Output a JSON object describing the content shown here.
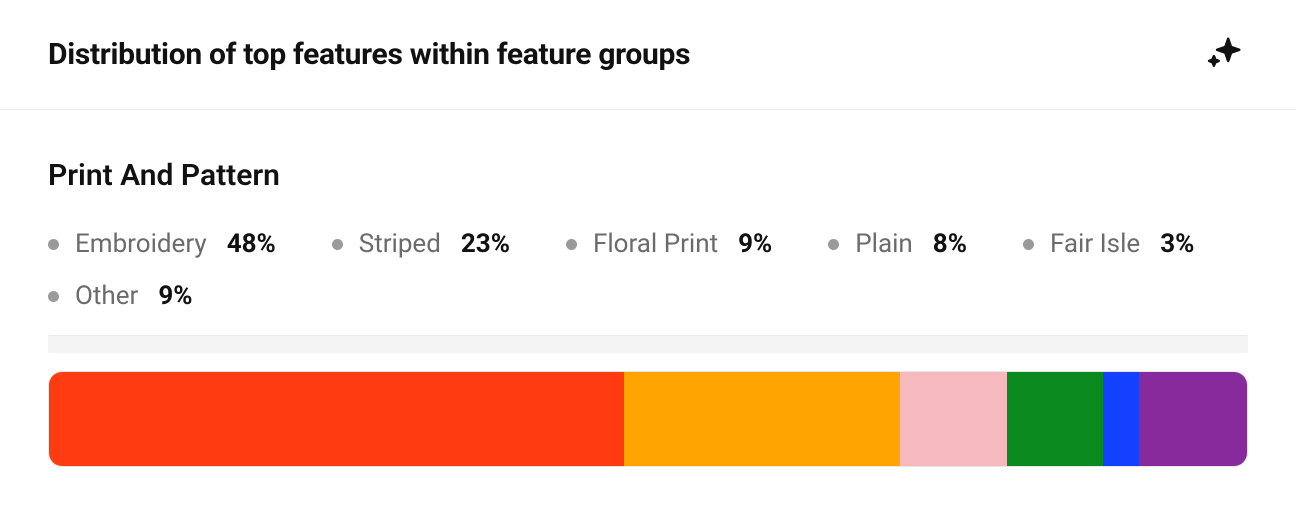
{
  "header": {
    "title": "Distribution of top features within feature groups",
    "sparkle_icon": "sparkle-icon"
  },
  "group": {
    "title": "Print And Pattern",
    "items": [
      {
        "label": "Embroidery",
        "value": "48%",
        "pct": 48,
        "color": "#ff3b12"
      },
      {
        "label": "Striped",
        "value": "23%",
        "pct": 23,
        "color": "#ffa400"
      },
      {
        "label": "Floral Print",
        "value": "9%",
        "pct": 9,
        "color": "#f6b9bd"
      },
      {
        "label": "Plain",
        "value": "8%",
        "pct": 8,
        "color": "#0a8a1e"
      },
      {
        "label": "Fair Isle",
        "value": "3%",
        "pct": 3,
        "color": "#1441ff"
      },
      {
        "label": "Other",
        "value": "9%",
        "pct": 9,
        "color": "#862a9c"
      }
    ]
  },
  "chart_data": {
    "type": "bar",
    "title": "Distribution of top features within feature groups",
    "group": "Print And Pattern",
    "categories": [
      "Embroidery",
      "Striped",
      "Floral Print",
      "Plain",
      "Fair Isle",
      "Other"
    ],
    "values": [
      48,
      23,
      9,
      8,
      3,
      9
    ],
    "unit": "%",
    "colors": [
      "#ff3b12",
      "#ffa400",
      "#f6b9bd",
      "#0a8a1e",
      "#1441ff",
      "#862a9c"
    ],
    "xlabel": "",
    "ylabel": "",
    "ylim": [
      0,
      100
    ]
  }
}
